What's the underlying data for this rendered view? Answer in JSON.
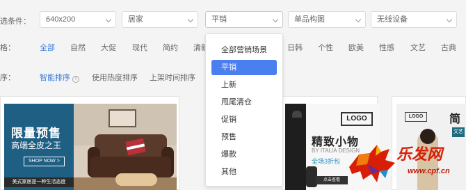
{
  "filters": {
    "label": "选条件：",
    "size": "640x200",
    "category": "居家",
    "scene": "平销",
    "layout": "单品构图",
    "device": "无线设备"
  },
  "styles": {
    "label": "格：",
    "items": [
      "全部",
      "自然",
      "大促",
      "现代",
      "简约",
      "清新",
      "日韩",
      "个性",
      "欧美",
      "性感",
      "文艺",
      "古典"
    ]
  },
  "sorts": {
    "label": "序：",
    "items": [
      "智能排序",
      "使用热度排序",
      "上架时间排序"
    ]
  },
  "dropdown": {
    "items": [
      "全部营销场景",
      "平销",
      "上新",
      "甩尾清仓",
      "促销",
      "预售",
      "爆款",
      "其他"
    ],
    "selected": "平销"
  },
  "cards": [
    {
      "title": "限量预售",
      "subtitle": "高端全皮之王",
      "button": "SHOP NOW >",
      "footer": "美式家居是一种生活态度"
    },
    {
      "logo": "LOGO",
      "title": "精致小物",
      "subtitle": "BY ITALIA DESIGN",
      "sale": "全场3折包",
      "button": "点击查看"
    },
    {
      "logo": "LOGO",
      "title": "简",
      "tag": "文艺"
    }
  ],
  "watermark": {
    "text": "乐发网",
    "url": "www.cpf.cn"
  },
  "colors": {
    "accent": "#3a7bd5",
    "dropdown_selected": "#4a7ff0",
    "banner1_blue": "#1f5f84",
    "watermark_red": "#d81e06"
  }
}
